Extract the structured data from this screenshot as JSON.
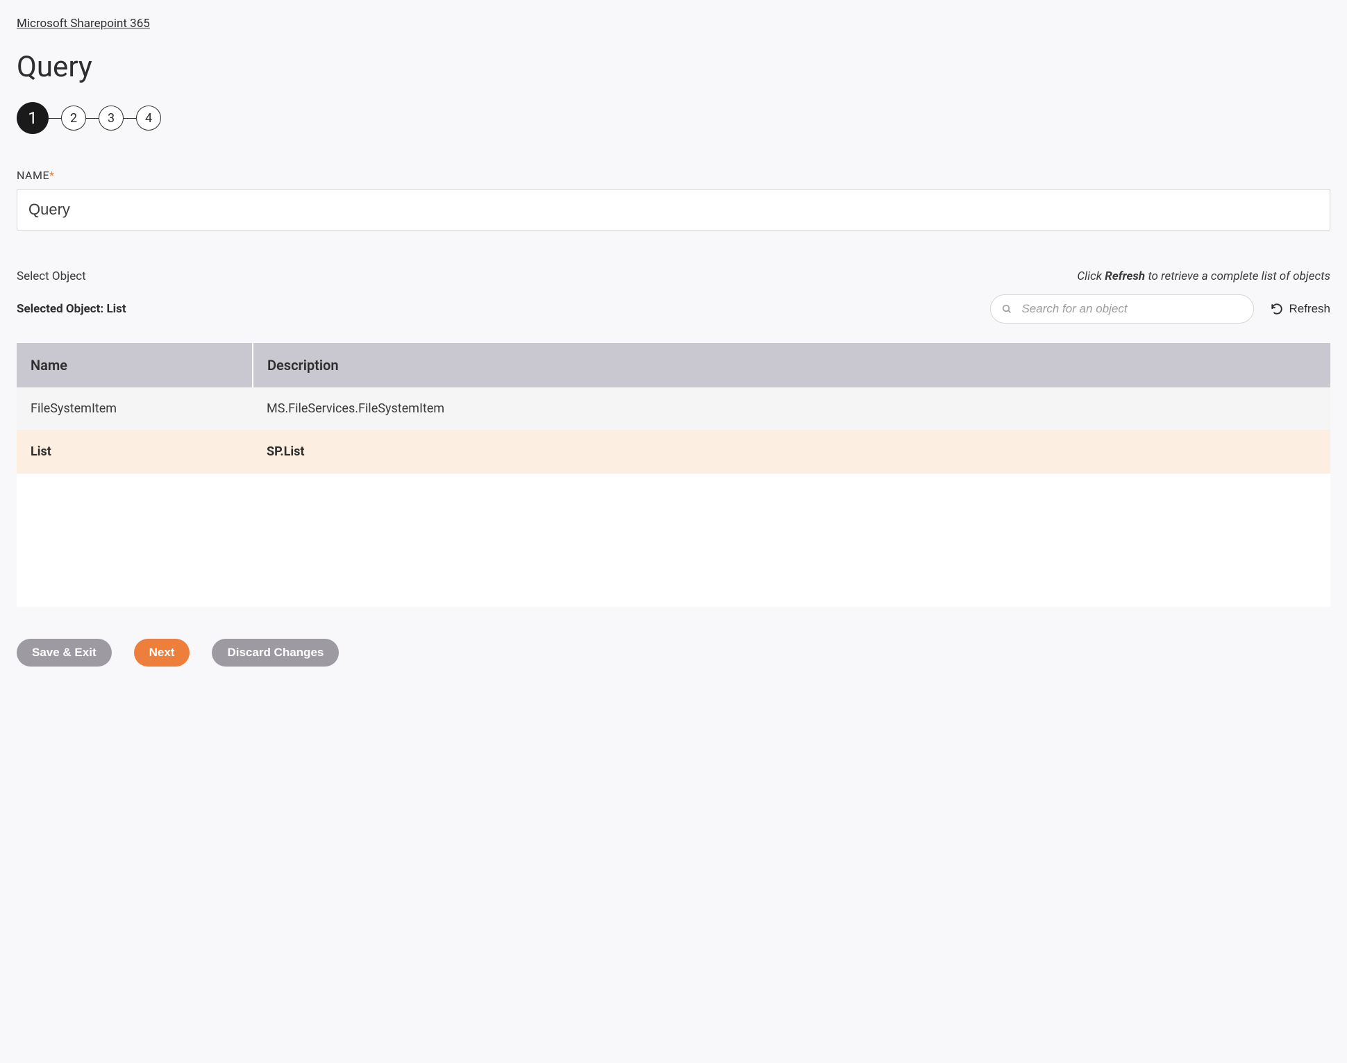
{
  "breadcrumb": "Microsoft Sharepoint 365",
  "page_title": "Query",
  "stepper": {
    "steps": [
      "1",
      "2",
      "3",
      "4"
    ],
    "active_index": 0
  },
  "form": {
    "name_label": "NAME",
    "name_value": "Query"
  },
  "select_object": {
    "section_label": "Select Object",
    "hint_prefix": "Click ",
    "hint_bold": "Refresh",
    "hint_suffix": " to retrieve a complete list of objects",
    "selected_prefix": "Selected Object: ",
    "selected_value": "List",
    "search_placeholder": "Search for an object",
    "refresh_label": "Refresh",
    "columns": {
      "name": "Name",
      "description": "Description"
    },
    "rows": [
      {
        "name": "FileSystemItem",
        "description": "MS.FileServices.FileSystemItem",
        "selected": false
      },
      {
        "name": "List",
        "description": "SP.List",
        "selected": true
      }
    ]
  },
  "footer": {
    "save_exit": "Save & Exit",
    "next": "Next",
    "discard": "Discard Changes"
  }
}
